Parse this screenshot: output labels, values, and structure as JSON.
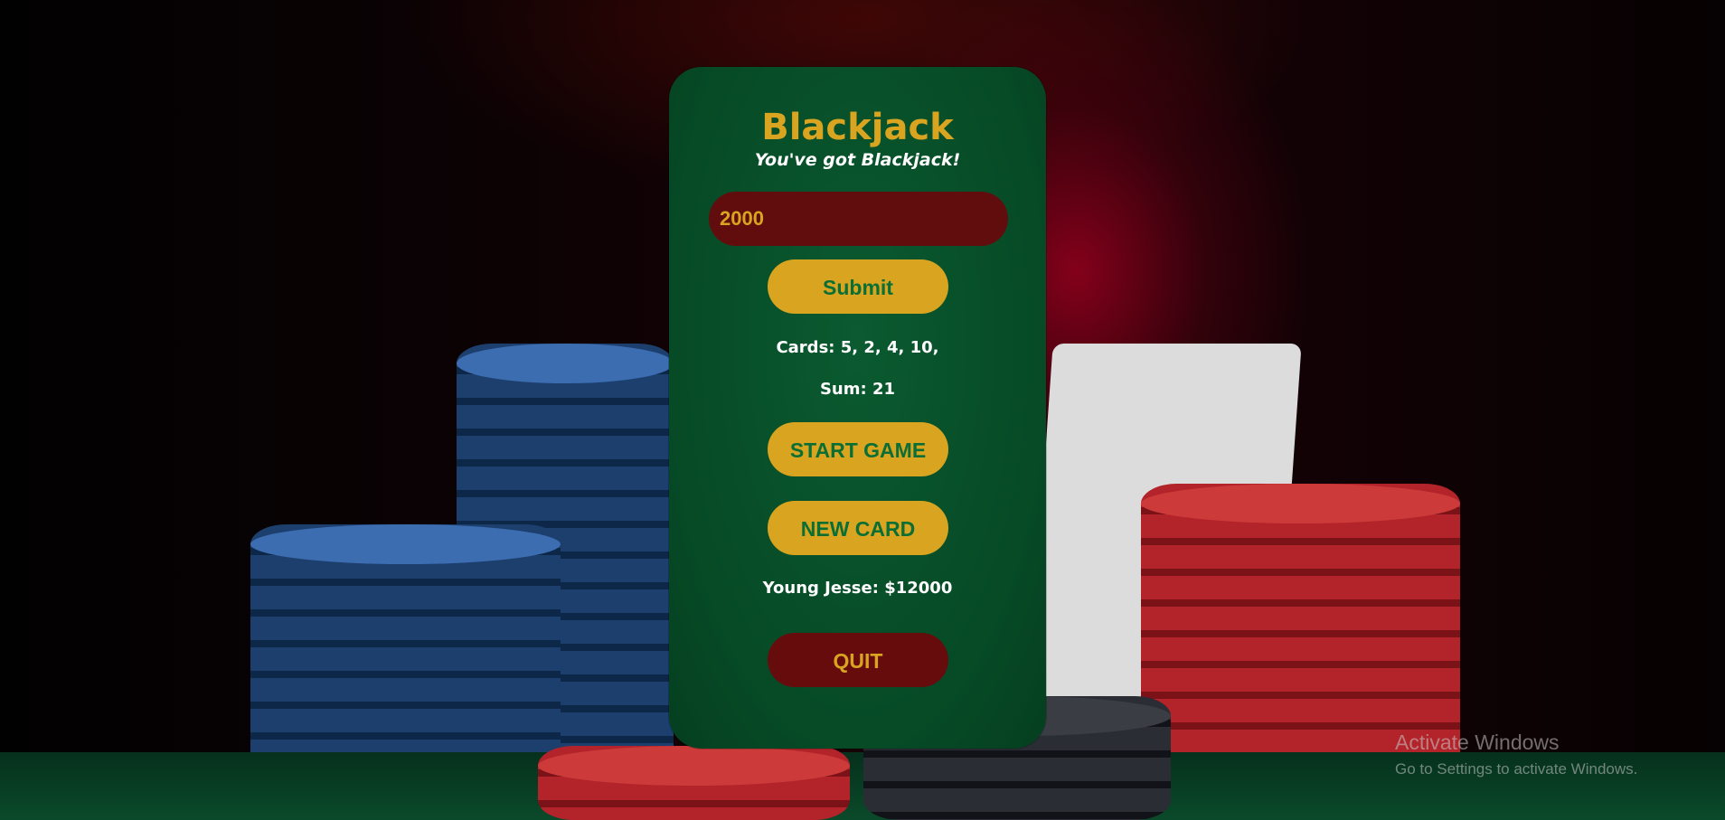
{
  "game": {
    "title": "Blackjack",
    "message": "You've got Blackjack!",
    "bet_input_value": "2000",
    "submit_label": "Submit",
    "cards_text": "Cards: 5, 2, 4, 10,",
    "sum_text": "Sum: 21",
    "start_game_label": "START GAME",
    "new_card_label": "NEW CARD",
    "player_text": "Young Jesse: $12000",
    "quit_label": "QUIT"
  },
  "watermark": {
    "title": "Activate Windows",
    "subtitle": "Go to Settings to activate Windows."
  },
  "colors": {
    "accent": "#d9a420",
    "panel": "#064a26",
    "dark_red": "#610d0d",
    "button_text": "#0a6e35"
  }
}
